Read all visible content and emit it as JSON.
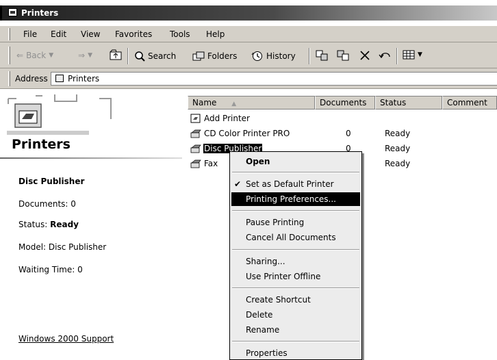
{
  "window": {
    "title": "Printers"
  },
  "menu": [
    "File",
    "Edit",
    "View",
    "Favorites",
    "Tools",
    "Help"
  ],
  "toolbar": {
    "back": "Back",
    "search": "Search",
    "folders": "Folders",
    "history": "History"
  },
  "address": {
    "label": "Address",
    "value": "Printers"
  },
  "left_pane": {
    "title": "Printers",
    "selected_name": "Disc Publisher",
    "documents": "Documents: 0",
    "status_label": "Status: ",
    "status_value": "Ready",
    "model": "Model: Disc Publisher",
    "waiting": "Waiting Time: 0",
    "support_link": "Windows 2000 Support"
  },
  "columns": [
    "Name",
    "Documents",
    "Status",
    "Comment"
  ],
  "sort_indicator": "▲",
  "rows": [
    {
      "name": "Add Printer",
      "documents": "",
      "status": ""
    },
    {
      "name": "CD Color Printer PRO",
      "documents": "0",
      "status": "Ready"
    },
    {
      "name": "Disc Publisher",
      "documents": "0",
      "status": "Ready"
    },
    {
      "name": "Fax",
      "documents": "",
      "status": "Ready"
    }
  ],
  "context_menu": {
    "open": "Open",
    "check_mark": "✔",
    "set_default": "Set as Default Printer",
    "printing_prefs": "Printing Preferences...",
    "pause": "Pause Printing",
    "cancel_all": "Cancel All Documents",
    "sharing": "Sharing...",
    "offline": "Use Printer Offline",
    "shortcut": "Create Shortcut",
    "delete": "Delete",
    "rename": "Rename",
    "properties": "Properties"
  },
  "colors": {
    "title_bar": "#1f1f1f",
    "face": "#d4d0c8",
    "highlight": "#000000"
  }
}
